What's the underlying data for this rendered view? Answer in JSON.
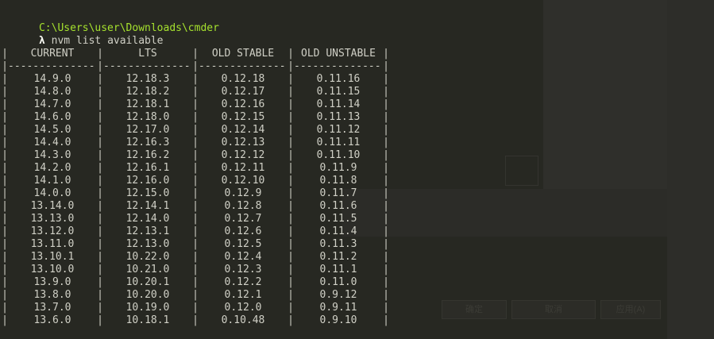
{
  "prompt": {
    "path": "C:\\Users\\user\\Downloads\\cmder",
    "lambda": "λ",
    "command": "nvm list available"
  },
  "ghost_buttons": [
    "确定",
    "取消",
    "应用(A)"
  ],
  "table": {
    "pipe": "|",
    "separator": "--------------",
    "headers": [
      "CURRENT",
      "LTS",
      "OLD STABLE",
      "OLD UNSTABLE"
    ],
    "rows": [
      [
        "14.9.0",
        "12.18.3",
        "0.12.18",
        "0.11.16"
      ],
      [
        "14.8.0",
        "12.18.2",
        "0.12.17",
        "0.11.15"
      ],
      [
        "14.7.0",
        "12.18.1",
        "0.12.16",
        "0.11.14"
      ],
      [
        "14.6.0",
        "12.18.0",
        "0.12.15",
        "0.11.13"
      ],
      [
        "14.5.0",
        "12.17.0",
        "0.12.14",
        "0.11.12"
      ],
      [
        "14.4.0",
        "12.16.3",
        "0.12.13",
        "0.11.11"
      ],
      [
        "14.3.0",
        "12.16.2",
        "0.12.12",
        "0.11.10"
      ],
      [
        "14.2.0",
        "12.16.1",
        "0.12.11",
        "0.11.9"
      ],
      [
        "14.1.0",
        "12.16.0",
        "0.12.10",
        "0.11.8"
      ],
      [
        "14.0.0",
        "12.15.0",
        "0.12.9",
        "0.11.7"
      ],
      [
        "13.14.0",
        "12.14.1",
        "0.12.8",
        "0.11.6"
      ],
      [
        "13.13.0",
        "12.14.0",
        "0.12.7",
        "0.11.5"
      ],
      [
        "13.12.0",
        "12.13.1",
        "0.12.6",
        "0.11.4"
      ],
      [
        "13.11.0",
        "12.13.0",
        "0.12.5",
        "0.11.3"
      ],
      [
        "13.10.1",
        "10.22.0",
        "0.12.4",
        "0.11.2"
      ],
      [
        "13.10.0",
        "10.21.0",
        "0.12.3",
        "0.11.1"
      ],
      [
        "13.9.0",
        "10.20.1",
        "0.12.2",
        "0.11.0"
      ],
      [
        "13.8.0",
        "10.20.0",
        "0.12.1",
        "0.9.12"
      ],
      [
        "13.7.0",
        "10.19.0",
        "0.12.0",
        "0.9.11"
      ],
      [
        "13.6.0",
        "10.18.1",
        "0.10.48",
        "0.9.10"
      ]
    ]
  },
  "colors": {
    "background": "#272822",
    "text": "#d0d0c6",
    "path": "#a6e22e",
    "lambda": "#f8f8f2"
  }
}
